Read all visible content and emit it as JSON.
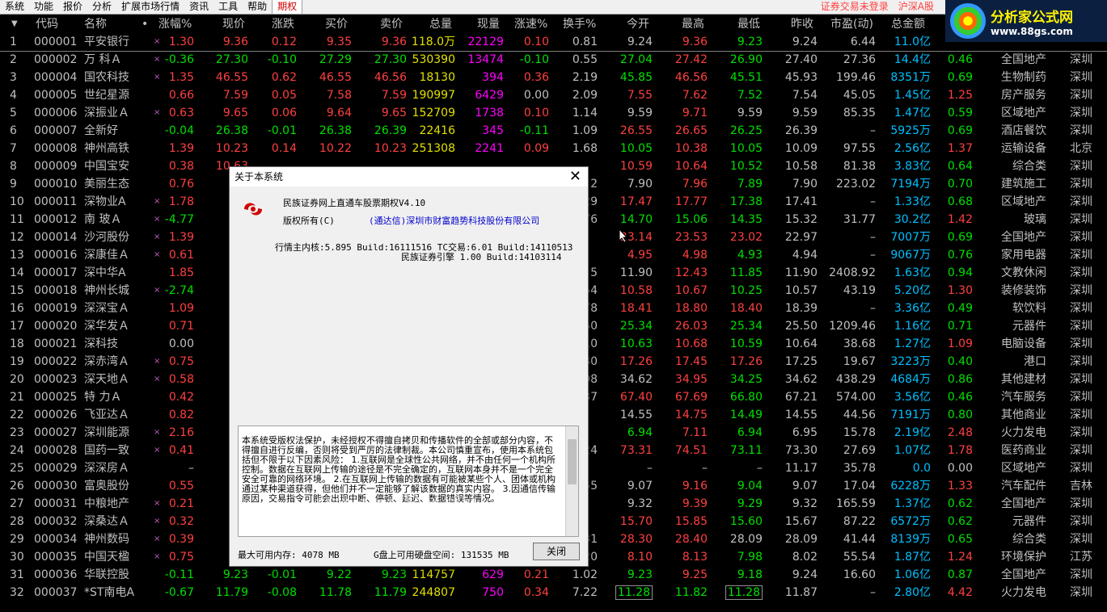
{
  "menu": {
    "items": [
      "系统",
      "功能",
      "报价",
      "分析",
      "扩展市场行情",
      "资讯",
      "工具",
      "帮助",
      "期权"
    ],
    "active": "期权",
    "status_login": "证券交易未登录",
    "market": "沪深A股"
  },
  "logo": {
    "title": "分析家公式网",
    "url": "www.88gs.com"
  },
  "columns": [
    "代码",
    "名称",
    "涨幅%",
    "现价",
    "涨跌",
    "买价",
    "卖价",
    "总量",
    "现量",
    "涨速%",
    "换手%",
    "今开",
    "最高",
    "最低",
    "昨收",
    "市盈(动)",
    "总金额",
    "量比",
    "细分行业",
    "地区"
  ],
  "rows": [
    {
      "i": "1",
      "code": "000001",
      "name": "平安银行",
      "chg": "1.30",
      "price": "9.36",
      "up": "0.12",
      "bid": "9.35",
      "ask": "9.36",
      "vol": "118.0万",
      "cur": "22129",
      "spd": "0.10",
      "turn": "0.81",
      "open": "9.24",
      "high": "9.36",
      "low": "9.23",
      "prev": "9.24",
      "pe": "6.44",
      "amt": "11.0亿",
      "lb": "",
      "ind": "",
      "area": "",
      "dir": "r"
    },
    {
      "i": "2",
      "code": "000002",
      "name": "万 科Ａ",
      "chg": "-0.36",
      "price": "27.30",
      "up": "-0.10",
      "bid": "27.29",
      "ask": "27.30",
      "vol": "530390",
      "cur": "13474",
      "spd": "-0.10",
      "turn": "0.55",
      "open": "27.04",
      "high": "27.42",
      "low": "26.90",
      "prev": "27.40",
      "pe": "27.36",
      "amt": "14.4亿",
      "lb": "0.46",
      "ind": "全国地产",
      "area": "深圳",
      "dir": "g"
    },
    {
      "i": "3",
      "code": "000004",
      "name": "国农科技",
      "chg": "1.35",
      "price": "46.55",
      "up": "0.62",
      "bid": "46.55",
      "ask": "46.56",
      "vol": "18130",
      "cur": "394",
      "spd": "0.36",
      "turn": "2.19",
      "open": "45.85",
      "high": "46.56",
      "low": "45.51",
      "prev": "45.93",
      "pe": "199.46",
      "amt": "8351万",
      "lb": "0.69",
      "ind": "生物制药",
      "area": "深圳",
      "dir": "r"
    },
    {
      "i": "4",
      "code": "000005",
      "name": "世纪星源",
      "chg": "0.66",
      "price": "7.59",
      "up": "0.05",
      "bid": "7.58",
      "ask": "7.59",
      "vol": "190997",
      "cur": "6429",
      "spd": "0.00",
      "turn": "2.09",
      "open": "7.55",
      "high": "7.62",
      "low": "7.52",
      "prev": "7.54",
      "pe": "45.05",
      "amt": "1.45亿",
      "lb": "1.25",
      "ind": "房产服务",
      "area": "深圳",
      "dir": "r"
    },
    {
      "i": "5",
      "code": "000006",
      "name": "深振业Ａ",
      "chg": "0.63",
      "price": "9.65",
      "up": "0.06",
      "bid": "9.64",
      "ask": "9.65",
      "vol": "152709",
      "cur": "1738",
      "spd": "0.10",
      "turn": "1.14",
      "open": "9.59",
      "high": "9.71",
      "low": "9.59",
      "prev": "9.59",
      "pe": "85.35",
      "amt": "1.47亿",
      "lb": "0.59",
      "ind": "区域地产",
      "area": "深圳",
      "dir": "r"
    },
    {
      "i": "6",
      "code": "000007",
      "name": "全新好",
      "chg": "-0.04",
      "price": "26.38",
      "up": "-0.01",
      "bid": "26.38",
      "ask": "26.39",
      "vol": "22416",
      "cur": "345",
      "spd": "-0.11",
      "turn": "1.09",
      "open": "26.55",
      "high": "26.65",
      "low": "26.25",
      "prev": "26.39",
      "pe": "–",
      "amt": "5925万",
      "lb": "0.69",
      "ind": "酒店餐饮",
      "area": "深圳",
      "dir": "g"
    },
    {
      "i": "7",
      "code": "000008",
      "name": "神州高铁",
      "chg": "1.39",
      "price": "10.23",
      "up": "0.14",
      "bid": "10.22",
      "ask": "10.23",
      "vol": "251308",
      "cur": "2241",
      "spd": "0.09",
      "turn": "1.68",
      "open": "10.05",
      "high": "10.38",
      "low": "10.05",
      "prev": "10.09",
      "pe": "97.55",
      "amt": "2.56亿",
      "lb": "1.37",
      "ind": "运输设备",
      "area": "北京",
      "dir": "r"
    },
    {
      "i": "8",
      "code": "000009",
      "name": "中国宝安",
      "chg": "0.38",
      "price": "10.63",
      "up": "",
      "bid": "",
      "ask": "",
      "vol": "",
      "cur": "",
      "spd": "",
      "turn": "",
      "open": "10.59",
      "high": "10.64",
      "low": "10.52",
      "prev": "10.58",
      "pe": "81.38",
      "amt": "3.83亿",
      "lb": "0.64",
      "ind": "综合类",
      "area": "深圳",
      "dir": "r"
    },
    {
      "i": "9",
      "code": "000010",
      "name": "美丽生态",
      "chg": "0.76",
      "price": "",
      "up": "",
      "bid": "",
      "ask": "",
      "vol": "",
      "cur": "",
      "spd": "",
      "turn": "2",
      "open": "7.90",
      "high": "7.96",
      "low": "7.89",
      "prev": "7.90",
      "pe": "223.02",
      "amt": "7194万",
      "lb": "0.70",
      "ind": "建筑施工",
      "area": "深圳",
      "dir": "r"
    },
    {
      "i": "10",
      "code": "000011",
      "name": "深物业A",
      "chg": "1.78",
      "price": "17",
      "up": "",
      "bid": "",
      "ask": "",
      "vol": "",
      "cur": "",
      "spd": "",
      "turn": "29",
      "open": "17.47",
      "high": "17.77",
      "low": "17.38",
      "prev": "17.41",
      "pe": "–",
      "amt": "1.33亿",
      "lb": "0.68",
      "ind": "区域地产",
      "area": "深圳",
      "dir": "r"
    },
    {
      "i": "11",
      "code": "000012",
      "name": "南 玻Ａ",
      "chg": "-4.77",
      "price": "14",
      "up": "",
      "bid": "",
      "ask": "",
      "vol": "",
      "cur": "",
      "spd": "",
      "turn": "76",
      "open": "14.70",
      "high": "15.06",
      "low": "14.35",
      "prev": "15.32",
      "pe": "31.77",
      "amt": "30.2亿",
      "lb": "1.42",
      "ind": "玻璃",
      "area": "深圳",
      "dir": "g"
    },
    {
      "i": "12",
      "code": "000014",
      "name": "沙河股份",
      "chg": "1.39",
      "price": "23",
      "up": "",
      "bid": "",
      "ask": "",
      "vol": "",
      "cur": "",
      "spd": "",
      "turn": "",
      "open": "23.14",
      "high": "23.53",
      "low": "23.02",
      "prev": "22.97",
      "pe": "–",
      "amt": "7007万",
      "lb": "0.69",
      "ind": "全国地产",
      "area": "深圳",
      "dir": "r"
    },
    {
      "i": "13",
      "code": "000016",
      "name": "深康佳Ａ",
      "chg": "0.61",
      "price": "4",
      "up": "",
      "bid": "",
      "ask": "",
      "vol": "",
      "cur": "",
      "spd": "",
      "turn": "",
      "open": "4.95",
      "high": "4.98",
      "low": "4.93",
      "prev": "4.94",
      "pe": "–",
      "amt": "9067万",
      "lb": "0.76",
      "ind": "家用电器",
      "area": "深圳",
      "dir": "r"
    },
    {
      "i": "14",
      "code": "000017",
      "name": "深中华A",
      "chg": "1.85",
      "price": "12",
      "up": "",
      "bid": "",
      "ask": "",
      "vol": "",
      "cur": "",
      "spd": "",
      "turn": "5",
      "open": "11.90",
      "high": "12.43",
      "low": "11.85",
      "prev": "11.90",
      "pe": "2408.92",
      "amt": "1.63亿",
      "lb": "0.94",
      "ind": "文教休闲",
      "area": "深圳",
      "dir": "r"
    },
    {
      "i": "15",
      "code": "000018",
      "name": "神州长城",
      "chg": "-2.74",
      "price": "10",
      "up": "",
      "bid": "",
      "ask": "",
      "vol": "",
      "cur": "",
      "spd": "",
      "turn": "54",
      "open": "10.58",
      "high": "10.67",
      "low": "10.25",
      "prev": "10.57",
      "pe": "43.19",
      "amt": "5.20亿",
      "lb": "1.30",
      "ind": "装修装饰",
      "area": "深圳",
      "dir": "g"
    },
    {
      "i": "16",
      "code": "000019",
      "name": "深深宝Ａ",
      "chg": "1.09",
      "price": "18",
      "up": "",
      "bid": "",
      "ask": "",
      "vol": "",
      "cur": "",
      "spd": "",
      "turn": "78",
      "open": "18.41",
      "high": "18.80",
      "low": "18.40",
      "prev": "18.39",
      "pe": "–",
      "amt": "3.36亿",
      "lb": "0.49",
      "ind": "软饮料",
      "area": "深圳",
      "dir": "r"
    },
    {
      "i": "17",
      "code": "000020",
      "name": "深华发Ａ",
      "chg": "0.71",
      "price": "25",
      "up": "",
      "bid": "",
      "ask": "",
      "vol": "",
      "cur": "",
      "spd": "",
      "turn": "50",
      "open": "25.34",
      "high": "26.03",
      "low": "25.34",
      "prev": "25.50",
      "pe": "1209.46",
      "amt": "1.16亿",
      "lb": "0.71",
      "ind": "元器件",
      "area": "深圳",
      "dir": "r"
    },
    {
      "i": "18",
      "code": "000021",
      "name": "深科技",
      "chg": "0.00",
      "price": "10",
      "up": "",
      "bid": "",
      "ask": "",
      "vol": "",
      "cur": "",
      "spd": "",
      "turn": "10",
      "open": "10.63",
      "high": "10.68",
      "low": "10.59",
      "prev": "10.64",
      "pe": "38.68",
      "amt": "1.27亿",
      "lb": "1.09",
      "ind": "电脑设备",
      "area": "深圳",
      "dir": "w"
    },
    {
      "i": "19",
      "code": "000022",
      "name": "深赤湾Ａ",
      "chg": "0.75",
      "price": "17",
      "up": "",
      "bid": "",
      "ask": "",
      "vol": "",
      "cur": "",
      "spd": "",
      "turn": "30",
      "open": "17.26",
      "high": "17.45",
      "low": "17.26",
      "prev": "17.25",
      "pe": "19.67",
      "amt": "3223万",
      "lb": "0.40",
      "ind": "港口",
      "area": "深圳",
      "dir": "r"
    },
    {
      "i": "20",
      "code": "000023",
      "name": "深天地Ａ",
      "chg": "0.58",
      "price": "34",
      "up": "",
      "bid": "",
      "ask": "",
      "vol": "",
      "cur": "",
      "spd": "",
      "turn": "08",
      "open": "34.62",
      "high": "34.95",
      "low": "34.25",
      "prev": "34.62",
      "pe": "438.29",
      "amt": "4684万",
      "lb": "0.86",
      "ind": "其他建材",
      "area": "深圳",
      "dir": "r"
    },
    {
      "i": "21",
      "code": "000025",
      "name": "特 力Ａ",
      "chg": "0.42",
      "price": "67",
      "up": "",
      "bid": "",
      "ask": "",
      "vol": "",
      "cur": "",
      "spd": "",
      "turn": "37",
      "open": "67.40",
      "high": "67.69",
      "low": "66.80",
      "prev": "67.21",
      "pe": "574.00",
      "amt": "3.56亿",
      "lb": "0.46",
      "ind": "汽车服务",
      "area": "深圳",
      "dir": "r"
    },
    {
      "i": "22",
      "code": "000026",
      "name": "飞亚达Ａ",
      "chg": "0.82",
      "price": "14",
      "up": "",
      "bid": "",
      "ask": "",
      "vol": "",
      "cur": "",
      "spd": "",
      "turn": "",
      "open": "14.55",
      "high": "14.75",
      "low": "14.49",
      "prev": "14.55",
      "pe": "44.56",
      "amt": "7191万",
      "lb": "0.80",
      "ind": "其他商业",
      "area": "深圳",
      "dir": "r"
    },
    {
      "i": "23",
      "code": "000027",
      "name": "深圳能源",
      "chg": "2.16",
      "price": "7",
      "up": "",
      "bid": "",
      "ask": "",
      "vol": "",
      "cur": "",
      "spd": "",
      "turn": "",
      "open": "6.94",
      "high": "7.11",
      "low": "6.94",
      "prev": "6.95",
      "pe": "15.78",
      "amt": "2.19亿",
      "lb": "2.48",
      "ind": "火力发电",
      "area": "深圳",
      "dir": "r"
    },
    {
      "i": "24",
      "code": "000028",
      "name": "国药一致",
      "chg": "0.41",
      "price": "73",
      "up": "",
      "bid": "",
      "ask": "",
      "vol": "",
      "cur": "",
      "spd": "",
      "turn": "24",
      "open": "73.31",
      "high": "74.51",
      "low": "73.11",
      "prev": "73.30",
      "pe": "27.69",
      "amt": "1.07亿",
      "lb": "1.78",
      "ind": "医药商业",
      "area": "深圳",
      "dir": "r"
    },
    {
      "i": "25",
      "code": "000029",
      "name": "深深房Ａ",
      "chg": "–",
      "price": "",
      "up": "",
      "bid": "",
      "ask": "",
      "vol": "",
      "cur": "",
      "spd": "",
      "turn": "",
      "open": "–",
      "high": "–",
      "low": "–",
      "prev": "11.17",
      "pe": "35.78",
      "amt": "0.0",
      "lb": "0.00",
      "ind": "区域地产",
      "area": "深圳",
      "dir": "w"
    },
    {
      "i": "26",
      "code": "000030",
      "name": "富奥股份",
      "chg": "0.55",
      "price": "",
      "up": "",
      "bid": "",
      "ask": "",
      "vol": "",
      "cur": "",
      "spd": "",
      "turn": "55",
      "open": "9.07",
      "high": "9.16",
      "low": "9.04",
      "prev": "9.07",
      "pe": "17.04",
      "amt": "6228万",
      "lb": "1.33",
      "ind": "汽车配件",
      "area": "吉林",
      "dir": "r"
    },
    {
      "i": "27",
      "code": "000031",
      "name": "中粮地产",
      "chg": "0.21",
      "price": "",
      "up": "",
      "bid": "",
      "ask": "",
      "vol": "",
      "cur": "",
      "spd": "",
      "turn": "",
      "open": "9.32",
      "high": "9.39",
      "low": "9.29",
      "prev": "9.32",
      "pe": "165.59",
      "amt": "1.37亿",
      "lb": "0.62",
      "ind": "全国地产",
      "area": "深圳",
      "dir": "r"
    },
    {
      "i": "28",
      "code": "000032",
      "name": "深桑达Ａ",
      "chg": "0.32",
      "price": "15",
      "up": "",
      "bid": "",
      "ask": "",
      "vol": "",
      "cur": "",
      "spd": "",
      "turn": "",
      "open": "15.70",
      "high": "15.85",
      "low": "15.60",
      "prev": "15.67",
      "pe": "87.22",
      "amt": "6572万",
      "lb": "0.62",
      "ind": "元器件",
      "area": "深圳",
      "dir": "r"
    },
    {
      "i": "29",
      "code": "000034",
      "name": "神州数码",
      "chg": "0.39",
      "price": "28",
      "up": "",
      "bid": "",
      "ask": "",
      "vol": "",
      "cur": "",
      "spd": "",
      "turn": "31",
      "open": "28.30",
      "high": "28.40",
      "low": "28.09",
      "prev": "28.09",
      "pe": "41.44",
      "amt": "8139万",
      "lb": "0.65",
      "ind": "综合类",
      "area": "深圳",
      "dir": "r"
    },
    {
      "i": "30",
      "code": "000035",
      "name": "中国天楹",
      "chg": "0.75",
      "price": "8",
      "up": "",
      "bid": "",
      "ask": "",
      "vol": "",
      "cur": "",
      "spd": "",
      "turn": "20",
      "open": "8.10",
      "high": "8.13",
      "low": "7.98",
      "prev": "8.02",
      "pe": "55.54",
      "amt": "1.87亿",
      "lb": "1.24",
      "ind": "环境保护",
      "area": "江苏",
      "dir": "r"
    },
    {
      "i": "31",
      "code": "000036",
      "name": "华联控股",
      "chg": "-0.11",
      "price": "9.23",
      "up": "-0.01",
      "bid": "9.22",
      "ask": "9.23",
      "vol": "114757",
      "cur": "629",
      "spd": "0.21",
      "turn": "1.02",
      "open": "9.23",
      "high": "9.25",
      "low": "9.18",
      "prev": "9.24",
      "pe": "16.60",
      "amt": "1.06亿",
      "lb": "0.87",
      "ind": "全国地产",
      "area": "深圳",
      "dir": "g"
    },
    {
      "i": "32",
      "code": "000037",
      "name": "*ST南电A",
      "chg": "-0.67",
      "price": "11.79",
      "up": "-0.08",
      "bid": "11.78",
      "ask": "11.79",
      "vol": "244807",
      "cur": "750",
      "spd": "0.34",
      "turn": "7.22",
      "open": "11.28",
      "high": "11.82",
      "low": "11.28",
      "prev": "11.87",
      "pe": "–",
      "amt": "2.80亿",
      "lb": "4.42",
      "ind": "火力发电",
      "area": "深圳",
      "dir": "g"
    }
  ],
  "dialog": {
    "title": "关于本系统",
    "product": "民族证券网上直通车股票期权V4.10",
    "copyright_label": "版权所有(C)",
    "copyright_owner": "(通达信)深圳市财富趋势科技股份有限公司",
    "core_line1": "行情主内核:5.895 Build:16111516 TC交易:6.01 Build:14110513",
    "core_line2": "民族证券引擎 1.00 Build:14103114",
    "notice": "本系统受版权法保护，未经授权不得擅自拷贝和传播软件的全部或部分内容，不得擅自进行反编，否则将受到严厉的法律制裁。本公司慎重宣布，使用本系统包括但不限于以下因素风险： 1.互联网是全球性公共网络，并不由任何一个机构所控制。数据在互联网上传输的途径是不完全确定的，互联网本身并不是一个完全安全可靠的网络环境。 2.在互联网上传输的数据有可能被某些个人、团体或机构通过某种渠道获得，但他们并不一定能够了解该数据的真实内容。 3.因通信传输原因，交易指令可能会出现中断、停顿、延迟、数据错误等情况。",
    "memory_label": "最大可用内存: 4078 MB",
    "disk_label": "G盘上可用硬盘空间: 131535 MB",
    "close_button": "关闭"
  },
  "watermark": "www.88gs.com"
}
